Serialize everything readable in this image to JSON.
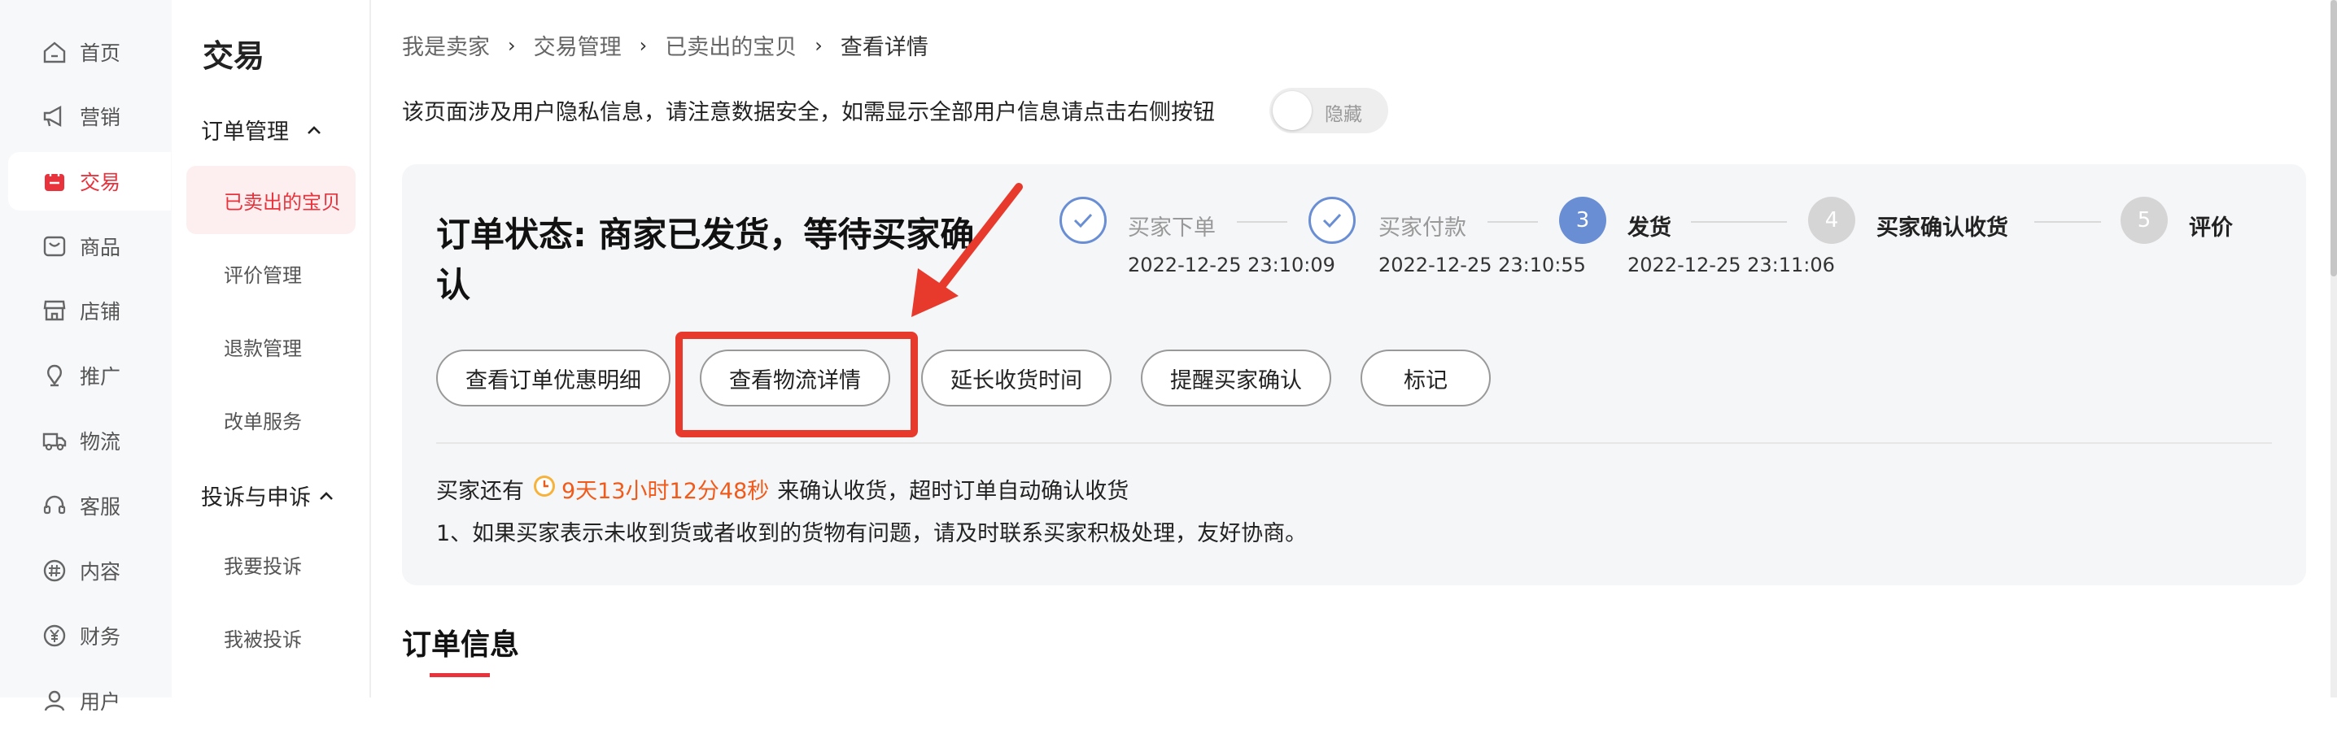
{
  "nav_main": [
    {
      "label": "首页",
      "icon": "home-icon",
      "active": false
    },
    {
      "label": "营销",
      "icon": "megaphone-icon",
      "active": false
    },
    {
      "label": "交易",
      "icon": "trade-icon",
      "active": true
    },
    {
      "label": "商品",
      "icon": "goods-icon",
      "active": false
    },
    {
      "label": "店铺",
      "icon": "store-icon",
      "active": false
    },
    {
      "label": "推广",
      "icon": "promote-icon",
      "active": false
    },
    {
      "label": "物流",
      "icon": "truck-icon",
      "active": false
    },
    {
      "label": "客服",
      "icon": "headset-icon",
      "active": false
    },
    {
      "label": "内容",
      "icon": "hash-icon",
      "active": false
    },
    {
      "label": "财务",
      "icon": "yuan-icon",
      "active": false
    },
    {
      "label": "用户",
      "icon": "user-icon",
      "active": false
    }
  ],
  "nav_sub": {
    "title": "交易",
    "groups": [
      {
        "label": "订单管理",
        "caret": "^",
        "items": [
          "已卖出的宝贝",
          "评价管理",
          "退款管理",
          "改单服务"
        ]
      },
      {
        "label": "投诉与申诉",
        "caret": "^",
        "items": [
          "我要投诉",
          "我被投诉"
        ]
      }
    ],
    "active_item": "已卖出的宝贝"
  },
  "breadcrumb": [
    "我是卖家",
    "交易管理",
    "已卖出的宝贝",
    "查看详情"
  ],
  "breadcrumb_sep": "›",
  "privacy_notice": "该页面涉及用户隐私信息，请注意数据安全，如需显示全部用户信息请点击右侧按钮",
  "privacy_toggle": {
    "label": "隐藏",
    "on": false
  },
  "order_status": "订单状态: 商家已发货，等待买家确认",
  "actions": [
    "查看订单优惠明细",
    "查看物流详情",
    "延长收货时间",
    "提醒买家确认",
    "标记"
  ],
  "highlighted_action": "查看物流详情",
  "steps": [
    {
      "label": "买家下单",
      "time": "2022-12-25 23:10:09",
      "state": "done",
      "number": "1"
    },
    {
      "label": "买家付款",
      "time": "2022-12-25 23:10:55",
      "state": "done",
      "number": "2"
    },
    {
      "label": "发货",
      "time": "2022-12-25 23:11:06",
      "state": "current",
      "number": "3"
    },
    {
      "label": "买家确认收货",
      "time": "",
      "state": "todo",
      "number": "4"
    },
    {
      "label": "评价",
      "time": "",
      "state": "todo",
      "number": "5"
    }
  ],
  "countdown": {
    "prefix": "买家还有",
    "time": "9天13小时12分48秒",
    "suffix": "来确认收货，超时订单自动确认收货"
  },
  "notice": "1、如果买家表示未收到货或者收到的货物有问题，请及时联系买家积极处理，友好协商。",
  "section_title": "订单信息",
  "colors": {
    "accent": "#e8323c",
    "step": "#6a8ed4",
    "annotation": "#e83a2c",
    "countdown": "#f05a1a"
  }
}
